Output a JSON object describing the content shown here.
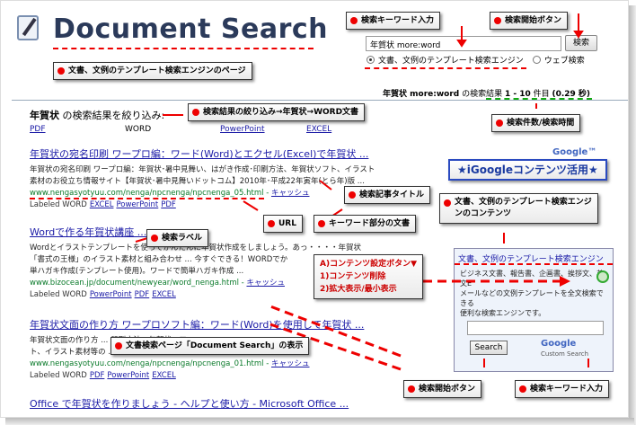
{
  "logo": {
    "text": "Document Search"
  },
  "search": {
    "query": "年賀状 more:word",
    "button_label": "検索",
    "radio_option_1": "文書、文例のテンプレート検索エンジン",
    "radio_option_2": "ウェブ検索"
  },
  "stats": {
    "query": "年賀状 more:word",
    "suffix": " の検索結果 ",
    "range": "1 - 10",
    "unit": " 件目 ",
    "time": "(0.29 秒)"
  },
  "refine": {
    "title_bold": "年賀状",
    "title_rest": " の検索結果を絞り込み:",
    "links": [
      "PDF",
      "WORD",
      "PowerPoint",
      "EXCEL"
    ]
  },
  "results": [
    {
      "title": "年賀状の宛名印刷 ワープロ編：ワード(Word)とエクセル(Excel)で年賀状 ...",
      "snippet_1": "年賀状の宛名印刷 ワープロ編：年賀状･暑中見舞い、はがき作成･印刷方法、年賀状ソフト、イラスト",
      "snippet_2": "素材のお役立ち情報サイト【年賀状･暑中見舞いドットコム】2010年･平成22年寅年(とら年)版 ...",
      "url": "www.nengasyotyuu.com/nenga/npcnenga/npcnenga_05.html",
      "cache": "キャッシュ",
      "labeled": "Labeled WORD",
      "labels": [
        "EXCEL",
        "PowerPoint",
        "PDF"
      ]
    },
    {
      "title": "Wordで作る年賀状講座 ...",
      "snippet_1": "Wordとイラストテンプレートを使ってかんたんに年賀状作成をしましょう。あっ・・・・年賀状",
      "snippet_2": "「書式の王様」のイラスト素材と組み合わせ ... 今すぐできる！WORDでか",
      "snippet_3": "単ハガキ作成(テンプレート使用)。ワードで簡単ハガキ作成 ...",
      "url": "www.bizocean.jp/document/newyear/word_nenga.html",
      "cache": "キャッシュ",
      "labeled": "Labeled WORD",
      "labels": [
        "PowerPoint",
        "PDF",
        "EXCEL"
      ]
    },
    {
      "title": "年賀状文面の作り方 ワープロソフト編：ワード(Word)を使用して年賀状 ...",
      "snippet_1": "年賀状文面の作り方 ... 印刷方法、年賀状ソフ",
      "snippet_2": "ト、イラスト素材等の ... 年賀状(とら年)版 ...",
      "url": "www.nengasyotyuu.com/nenga/npcnenga/npcnenga_01.html",
      "cache": "キャッシュ",
      "labeled": "Labeled WORD",
      "labels": [
        "PDF",
        "PowerPoint",
        "EXCEL"
      ]
    },
    {
      "title": "Office で年賀状を作りましょう - ヘルプと使い方 - Microsoft Office ..."
    }
  ],
  "google_mini": "Google™",
  "gadget": {
    "title": "文書、文例のテンプレート検索エンジン",
    "desc_1": "ビジネス文書、報告書、企画書、挨拶文、英文E",
    "desc_2": "メールなどの文例テンプレートを全文検索できる",
    "desc_3": "便利な検索エンジンです。",
    "button": "Search",
    "google": "Google",
    "cs": "Custom Search"
  },
  "callouts": {
    "keyword_input": "検索キーワード入力",
    "search_button": "検索開始ボタン",
    "page_desc": "文書、文例のテンプレート検索エンジンのページ",
    "refine_flow": "検索結果の絞り込み→年賀状→WORD文書",
    "result_count": "検索件数/検索時間",
    "igoogle": "★iGoogleコンテンツ活用★",
    "article_title": "検索記事タイトル",
    "gadget_content_1": "文書、文例のテンプレート検索エンジ",
    "gadget_content_2": "ンのコンテンツ",
    "url": "URL",
    "keyword_part": "キーワード部分の文書",
    "search_label": "検索ラベル",
    "settings_1": "A)コンテンツ設定ボタン▼",
    "settings_2": "1)コンテンツ削除",
    "settings_3": "2)拡大表示/最小表示",
    "doc_search_display": "文書検索ページ「Document Search」の表示",
    "bottom_search_button": "検索開始ボタン",
    "bottom_keyword_input": "検索キーワード入力"
  }
}
